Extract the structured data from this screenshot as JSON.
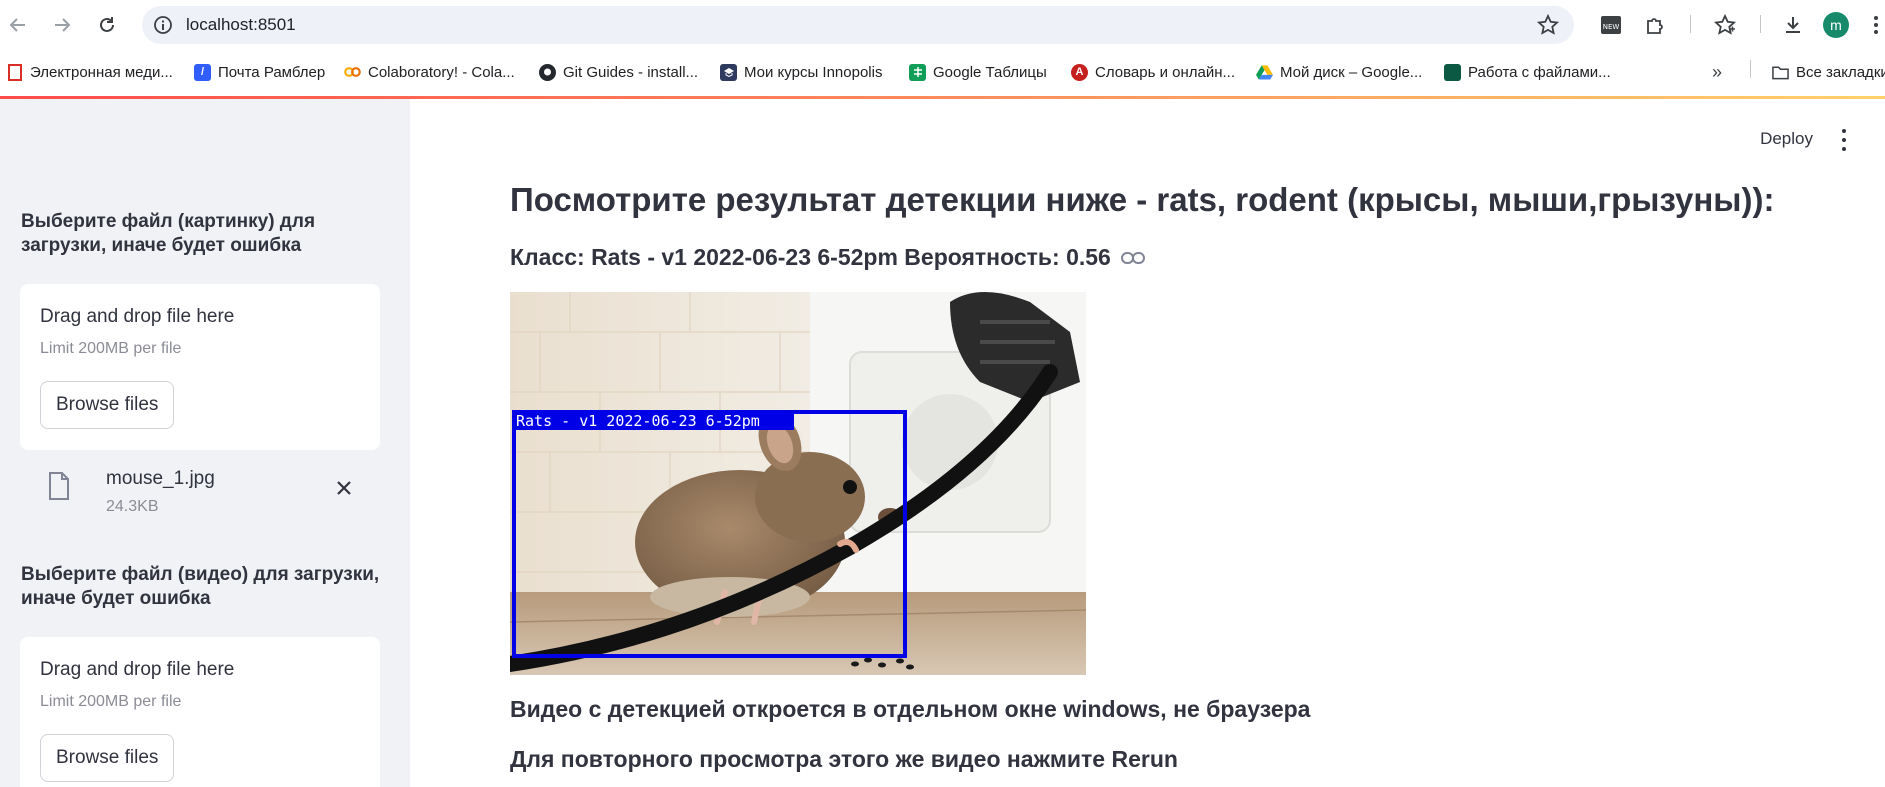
{
  "browser": {
    "url": "localhost:8501",
    "bookmarks": [
      {
        "label": "Электронная меди...",
        "icon": "bookmark-red-icon"
      },
      {
        "label": "Почта Рамблер",
        "icon": "rambler-icon"
      },
      {
        "label": "Colaboratory! - Cola...",
        "icon": "colab-icon"
      },
      {
        "label": "Git Guides - install...",
        "icon": "github-icon"
      },
      {
        "label": "Мои курсы Innopolis",
        "icon": "innopolis-icon"
      },
      {
        "label": "Google Таблицы",
        "icon": "sheets-icon"
      },
      {
        "label": "Словарь и онлайн...",
        "icon": "dictionary-icon"
      },
      {
        "label": "Мой диск – Google...",
        "icon": "drive-icon"
      },
      {
        "label": "Работа с файлами...",
        "icon": "files-icon"
      }
    ],
    "all_bookmarks": "Все закладки",
    "avatar_letter": "m",
    "accent": "#ff4b4b"
  },
  "sidebar": {
    "image_label": "Выберите файл (картинку) для загрузки, иначе будет ошибка",
    "video_label": "Выберите файл (видео) для загрузки, иначе будет ошибка",
    "drag_drop": "Drag and drop file here",
    "limit": "Limit 200MB per file",
    "browse": "Browse files",
    "uploaded_file": {
      "name": "mouse_1.jpg",
      "size": "24.3KB"
    }
  },
  "main": {
    "deploy": "Deploy",
    "title": "Посмотрите результат детекции ниже - rats, rodent (крысы, мыши,грызуны)):",
    "result": "Класс: Rats - v1 2022-06-23 6-52pm Вероятность: 0.56",
    "detection_label": "Rats - v1 2022-06-23 6-52pm",
    "video_note": "Видео с детекцией откроется в отдельном окне windows, не браузера",
    "rerun_note": "Для повторного просмотра этого же видео нажмите Rerun"
  }
}
